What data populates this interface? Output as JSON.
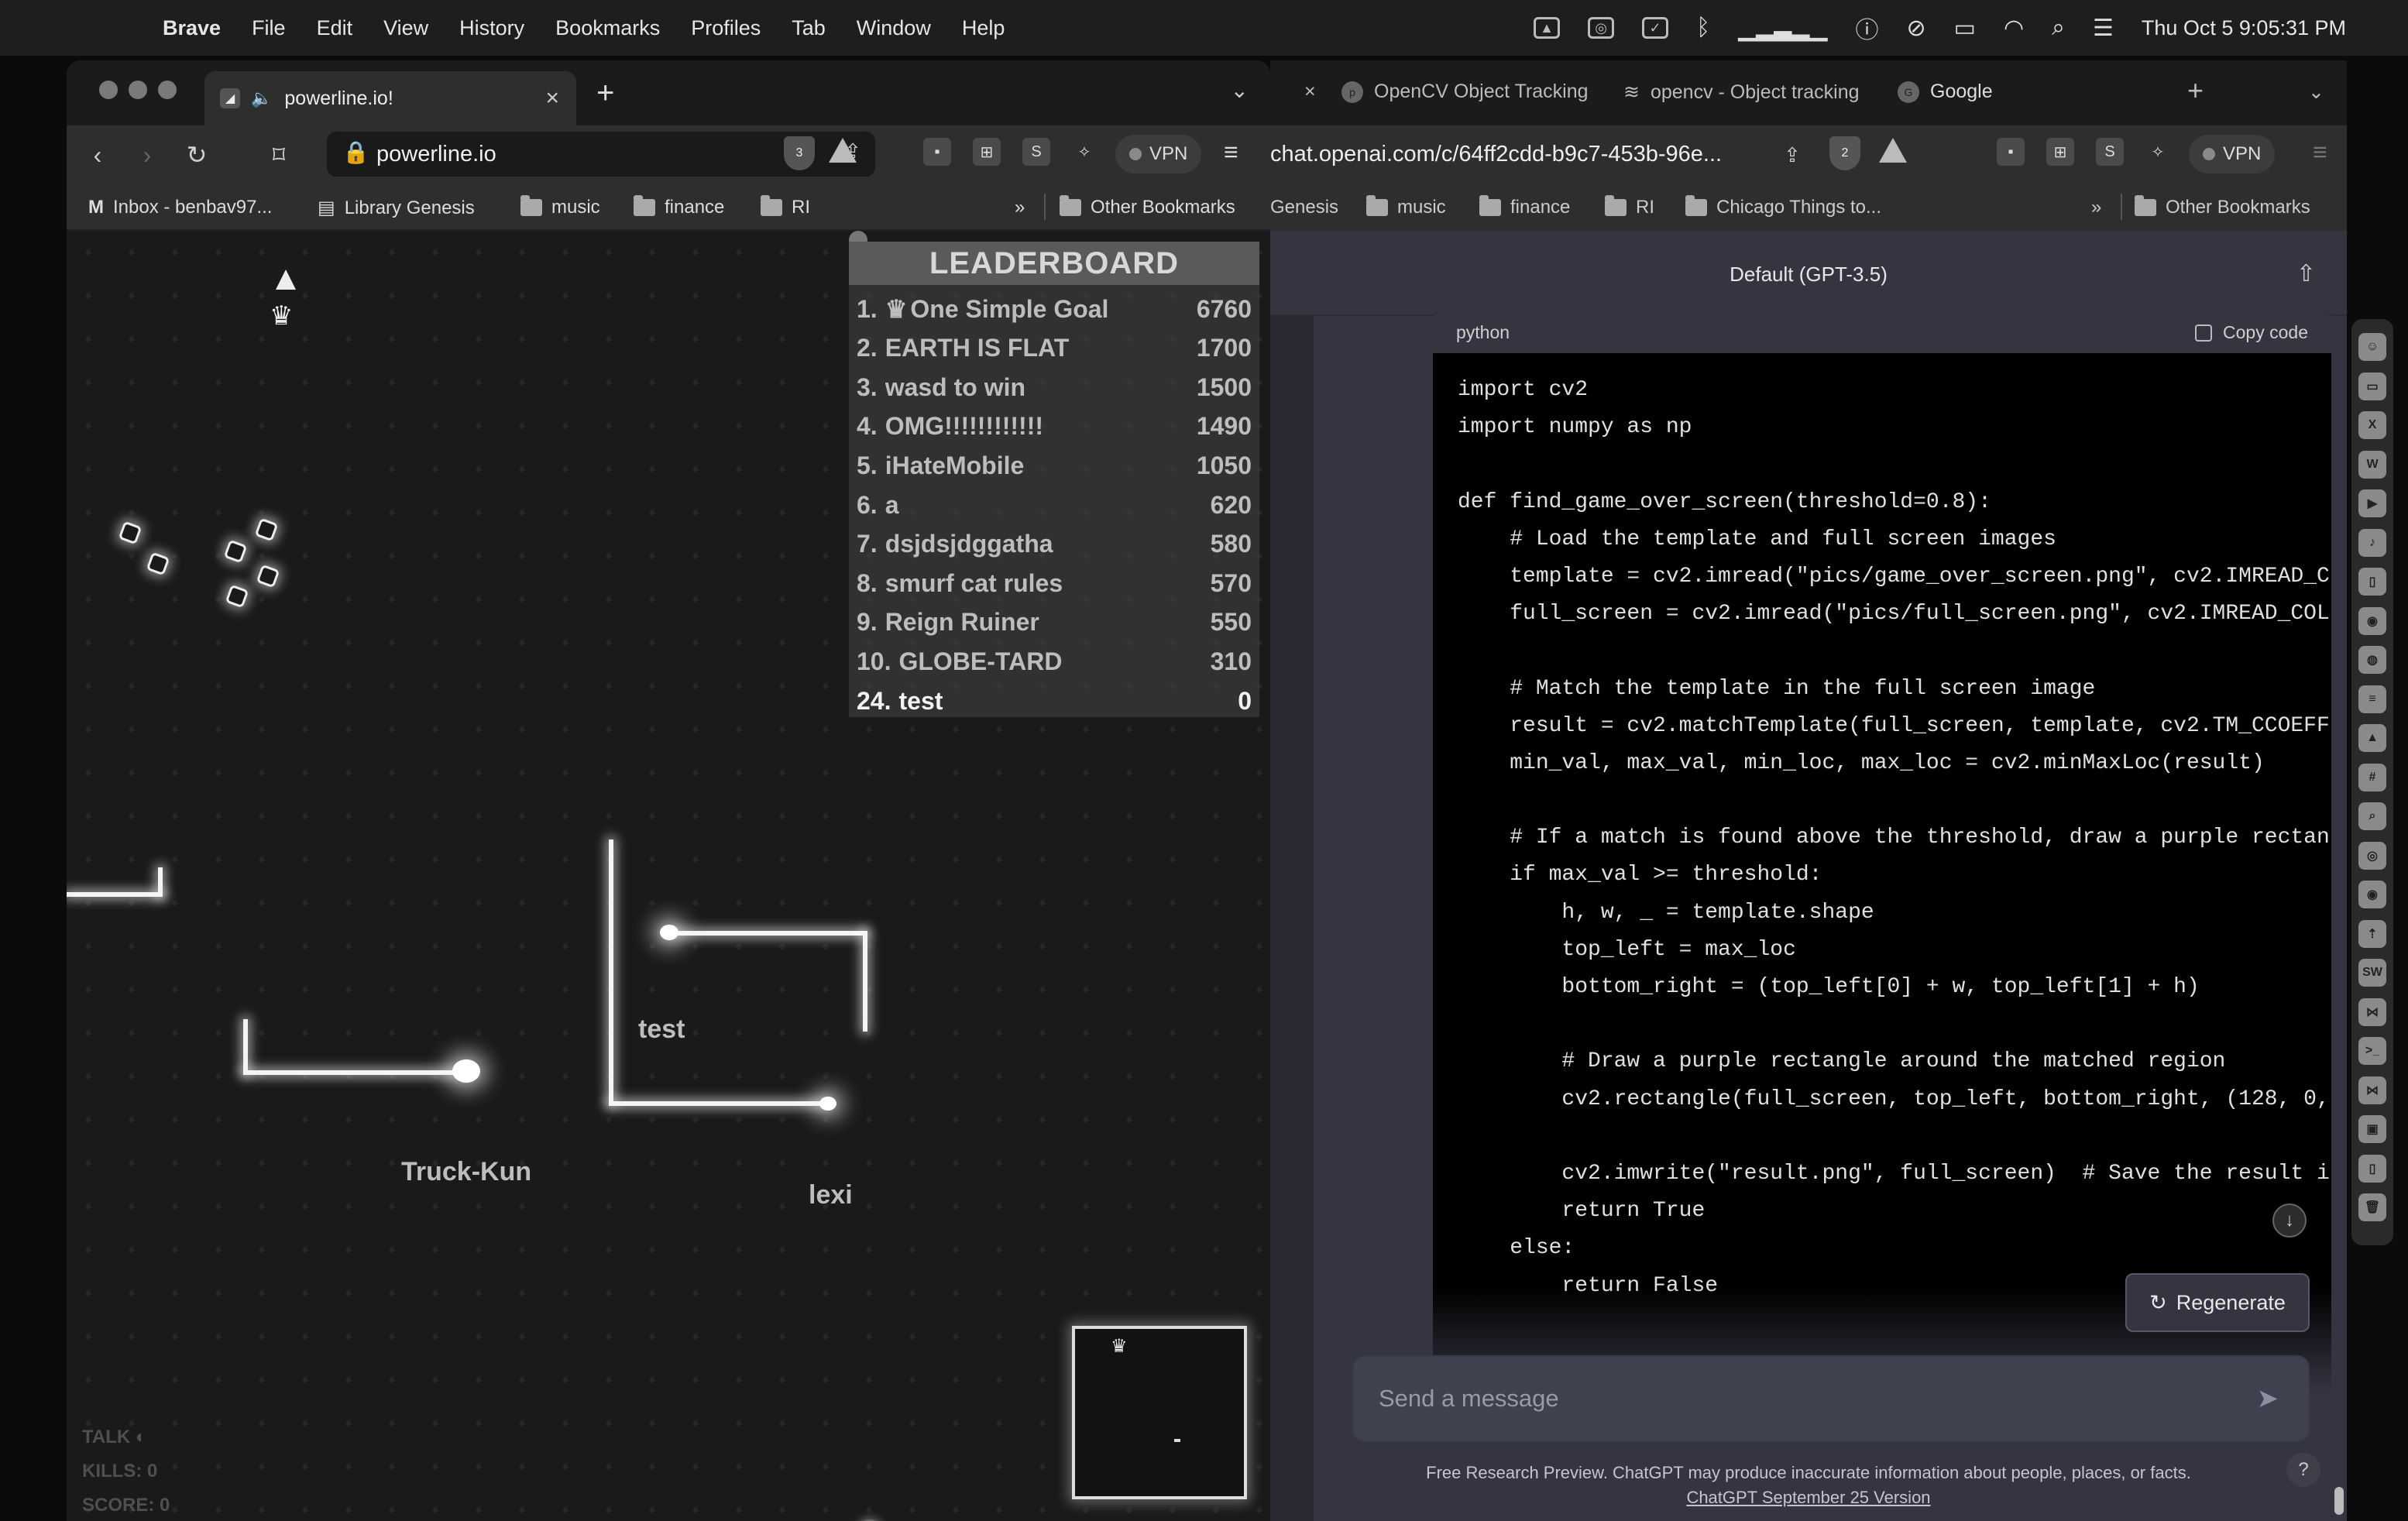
{
  "menubar": {
    "app": "Brave",
    "items": [
      "File",
      "Edit",
      "View",
      "History",
      "Bookmarks",
      "Profiles",
      "Tab",
      "Window",
      "Help"
    ],
    "clock": "Thu Oct 5  9:05:31 PM"
  },
  "left_window": {
    "tab_title": "powerline.io!",
    "url": "powerline.io",
    "shield_count": "3",
    "vpn_label": "VPN",
    "bookmarks": [
      "Inbox - benbav97...",
      "Library Genesis",
      "music",
      "finance",
      "RI"
    ],
    "bookmarks_more": "»",
    "other_bookmarks": "Other Bookmarks",
    "game": {
      "leaderboard_title": "LEADERBOARD",
      "leaderboard": [
        {
          "rank": "1.",
          "name": "One Simple Goal",
          "score": "6760",
          "crown": true
        },
        {
          "rank": "2.",
          "name": "EARTH IS FLAT",
          "score": "1700"
        },
        {
          "rank": "3.",
          "name": "wasd to win",
          "score": "1500"
        },
        {
          "rank": "4.",
          "name": "OMG!!!!!!!!!!!!",
          "score": "1490"
        },
        {
          "rank": "5.",
          "name": "iHateMobile",
          "score": "1050"
        },
        {
          "rank": "6.",
          "name": "a",
          "score": "620"
        },
        {
          "rank": "7.",
          "name": "dsjdsjdggatha",
          "score": "580"
        },
        {
          "rank": "8.",
          "name": "smurf cat rules",
          "score": "570"
        },
        {
          "rank": "9.",
          "name": "Reign Ruiner",
          "score": "550"
        },
        {
          "rank": "10.",
          "name": "GLOBE-TARD",
          "score": "310"
        },
        {
          "rank": "24.",
          "name": "test",
          "score": "0",
          "me": true
        }
      ],
      "players": [
        "test",
        "Truck-Kun",
        "lexi"
      ],
      "stats": {
        "talk": "TALK",
        "kills": "KILLS: 0",
        "score": "SCORE: 0"
      }
    }
  },
  "right_window": {
    "tabs": [
      "OpenCV Object Tracking",
      "opencv - Object tracking",
      "Google"
    ],
    "url": "chat.openai.com/c/64ff2cdd-b9c7-453b-96e...",
    "shield_count": "2",
    "vpn_label": "VPN",
    "bookmarks": [
      "Genesis",
      "music",
      "finance",
      "RI",
      "Chicago Things to..."
    ],
    "other_bookmarks": "Other Bookmarks",
    "model_title": "Default (GPT-3.5)",
    "code_lang": "python",
    "copy_label": "Copy code",
    "code_lines": [
      "import cv2",
      "import numpy as np",
      "",
      "def find_game_over_screen(threshold=0.8):",
      "    # Load the template and full screen images",
      "    template = cv2.imread(\"pics/game_over_screen.png\", cv2.IMREAD_C",
      "    full_screen = cv2.imread(\"pics/full_screen.png\", cv2.IMREAD_COL",
      "",
      "    # Match the template in the full screen image",
      "    result = cv2.matchTemplate(full_screen, template, cv2.TM_CCOEFF",
      "    min_val, max_val, min_loc, max_loc = cv2.minMaxLoc(result)",
      "",
      "    # If a match is found above the threshold, draw a purple rectan",
      "    if max_val >= threshold:",
      "        h, w, _ = template.shape",
      "        top_left = max_loc",
      "        bottom_right = (top_left[0] + w, top_left[1] + h)",
      "",
      "        # Draw a purple rectangle around the matched region",
      "        cv2.rectangle(full_screen, top_left, bottom_right, (128, 0,",
      "",
      "        cv2.imwrite(\"result.png\", full_screen)  # Save the result i",
      "        return True",
      "    else:",
      "        return False"
    ],
    "regenerate_label": "Regenerate",
    "message_placeholder": "Send a message",
    "footnote": "Free Research Preview. ChatGPT may produce inaccurate information about people, places, or facts.",
    "version": "ChatGPT September 25 Version",
    "help": "?"
  },
  "colors": {
    "accent": "#f4f4f4",
    "chat_bg": "#343541",
    "code_bg": "#000000"
  }
}
